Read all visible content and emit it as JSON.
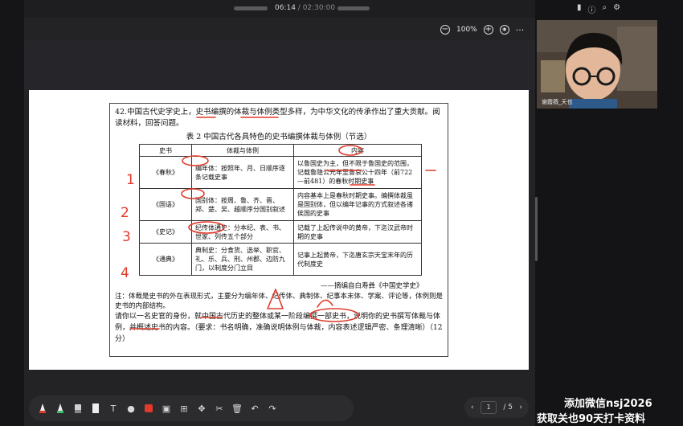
{
  "player": {
    "time_current": "06:14",
    "time_total": " / 02:30:00"
  },
  "viewer": {
    "zoom_minus": "−",
    "zoom_level": "100%",
    "zoom_plus": "+",
    "more": "···"
  },
  "question": {
    "head": "42.中国古代史学史上，史书编撰的体裁与体例类型多样，为中华文化的传承作出了重大贡献。阅读材料，回答问题。",
    "table_title": "表 2   中国古代各具特色的史书编撰体裁与体例（节选）",
    "table_headers": [
      "史书",
      "体裁与体例",
      "内容"
    ],
    "rows": [
      {
        "book": "《春秋》",
        "style": "编年体：按照年、月、日顺序逐条记载史事",
        "content": "以鲁国史为主，但不限于鲁国史的范围，记载鲁隐公元年至鲁哀公十四年（前722—前481）的春秋时期史事"
      },
      {
        "book": "《国语》",
        "style": "国别体：按周、鲁、齐、晋、郑、楚、吴、越顺序分国别叙述",
        "content": "内容基本上是春秋时期史事。编撰体裁虽是国别体，但以编年记事的方式叙述各诸侯国的史事"
      },
      {
        "book": "《史记》",
        "style": "纪传体通史：分本纪、表、书、世家、列传五个部分",
        "content": "记载了上起传说中的黄帝，下迄汉武帝时期的史事"
      },
      {
        "book": "《通典》",
        "style": "典制史：分食货、选举、职官、礼、乐、兵、刑、州郡、边防九门，以制度分门立目",
        "content": "记事上起黄帝，下迄唐玄宗天宝末年的历代制度史"
      }
    ],
    "source": "——摘编自白寿彝《中国史学史》",
    "note": "注：体裁是史书的外在表现形式，主要分为编年体、纪传体、典制体、纪事本末体、学案、评论等，体例则是史书的内部结构。",
    "task": "请你以一名史官的身份，就中国古代历史的整体或某一阶段编撰一部史书，说明你的史书撰写体裁与体例，并概述史书的内容。（要求：书名明确，准确说明体例与体裁，内容表述逻辑严密、条理清晰）（12 分）"
  },
  "annotations": {
    "numbers": [
      "1",
      "2",
      "3",
      "4"
    ]
  },
  "webcam": {
    "name_label": "谢霞薇_天也"
  },
  "toolbar": {
    "tools": [
      "pen-red",
      "highlighter-green",
      "eraser",
      "marker-white",
      "text",
      "shape",
      "color-red",
      "image",
      "add",
      "move",
      "cut",
      "delete",
      "undo",
      "redo"
    ]
  },
  "pager": {
    "current": "1",
    "total": "/ 5",
    "prev": "‹",
    "next": "›"
  },
  "watermark": {
    "line1": "添加微信nsj2026",
    "line2": "获取关也90天打卡资料"
  }
}
